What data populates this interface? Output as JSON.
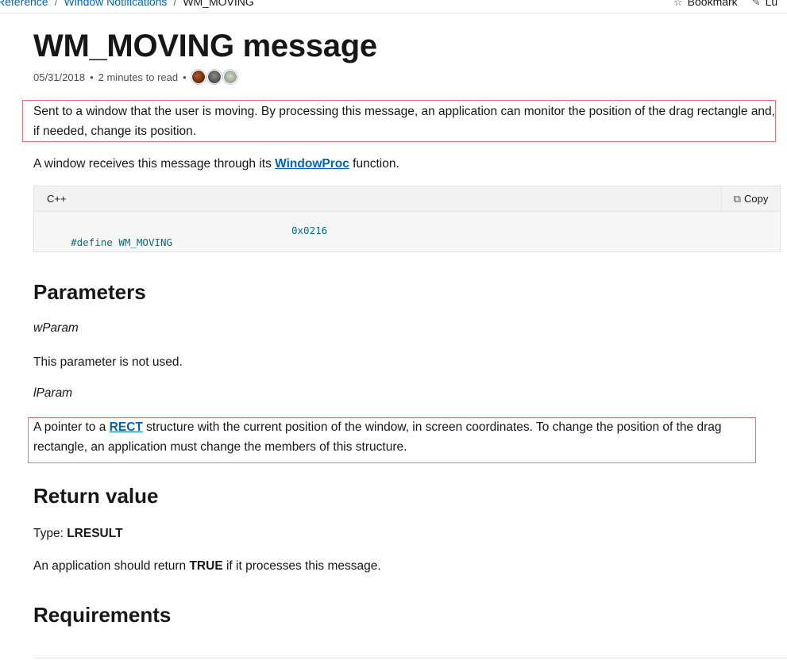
{
  "breadcrumb": {
    "items": [
      "Reference",
      "Window Notifications"
    ],
    "separator": "/",
    "current": "WM_MOVING"
  },
  "top_actions": {
    "bookmark_label": "Bookmark",
    "bookmark_icon": "bookmark-icon",
    "second_label": "Lu",
    "second_icon": "edit-icon"
  },
  "page": {
    "title": "WM_MOVING message",
    "date": "05/31/2018",
    "bullet": "•",
    "read_time": "2 minutes to read",
    "contributors": [
      "contributor-1",
      "contributor-2",
      "contributor-3"
    ]
  },
  "intro": {
    "description": "Sent to a window that the user is moving. By processing this message, an application can monitor the position of the drag rectangle and, if needed, change its position.",
    "receive_prefix": "A window receives this message through its ",
    "receive_link": "WindowProc",
    "receive_suffix": " function."
  },
  "code_block": {
    "language": "C++",
    "copy_label": "Copy",
    "copy_icon": "copy-icon",
    "define": "#define WM_MOVING",
    "value": "0x0216"
  },
  "parameters": {
    "heading": "Parameters",
    "wparam_name": "wParam",
    "wparam_desc": "This parameter is not used.",
    "lparam_name": "lParam",
    "lparam_prefix": "A pointer to a ",
    "lparam_link": "RECT",
    "lparam_suffix": " structure with the current position of the window, in screen coordinates. To change the position of the drag rectangle, an application must change the members of this structure."
  },
  "return_value": {
    "heading": "Return value",
    "type_prefix": "Type: ",
    "type": "LRESULT",
    "desc_prefix": "An application should return ",
    "desc_bold": "TRUE",
    "desc_suffix": " if it processes this message."
  },
  "requirements": {
    "heading": "Requirements"
  },
  "colors": {
    "link": "#0065b3",
    "highlight_border": "#f07077",
    "code_text": "#0a6e78"
  }
}
